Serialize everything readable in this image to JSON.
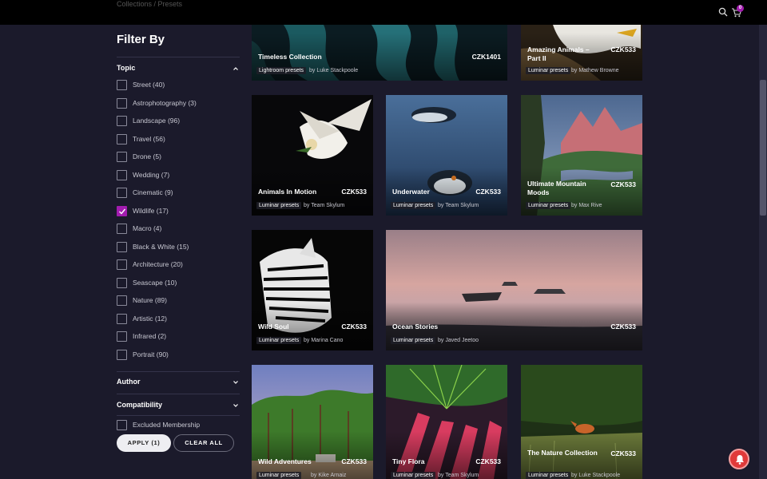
{
  "header": {
    "breadcrumb": "Collections / Presets",
    "cart_count": "0"
  },
  "sidebar": {
    "title": "Filter By",
    "topic_label": "Topic",
    "topics": [
      {
        "label": "Street (40)",
        "checked": false
      },
      {
        "label": "Astrophotography (3)",
        "checked": false
      },
      {
        "label": "Landscape (96)",
        "checked": false
      },
      {
        "label": "Travel (56)",
        "checked": false
      },
      {
        "label": "Drone (5)",
        "checked": false
      },
      {
        "label": "Wedding (7)",
        "checked": false
      },
      {
        "label": "Cinematic (9)",
        "checked": false
      },
      {
        "label": "Wildlife (17)",
        "checked": true
      },
      {
        "label": "Macro (4)",
        "checked": false
      },
      {
        "label": "Black & White (15)",
        "checked": false
      },
      {
        "label": "Architecture (20)",
        "checked": false
      },
      {
        "label": "Seascape (10)",
        "checked": false
      },
      {
        "label": "Nature (89)",
        "checked": false
      },
      {
        "label": "Artistic (12)",
        "checked": false
      },
      {
        "label": "Infrared (2)",
        "checked": false
      },
      {
        "label": "Portrait (90)",
        "checked": false
      }
    ],
    "author_label": "Author",
    "compatibility_label": "Compatibility",
    "excluded": {
      "label": "Excluded Membership",
      "checked": false
    },
    "apply_label": "APPLY (1)",
    "clear_label": "CLEAR ALL"
  },
  "products": [
    {
      "title": "Timeless Collection",
      "code": "CZK1401",
      "type": "Lightroom presets",
      "author": "by Luke Stackpoole"
    },
    {
      "title": "Amazing Animals – Part II",
      "code": "CZK533",
      "type": "Luminar presets",
      "author": "by Mathew Browne"
    },
    {
      "title": "Animals In Motion",
      "code": "CZK533",
      "type": "Luminar presets",
      "author": "by Team Skylum"
    },
    {
      "title": "Underwater",
      "code": "CZK533",
      "type": "Luminar presets",
      "author": "by Team Skylum"
    },
    {
      "title": "Ultimate Mountain Moods",
      "code": "CZK533",
      "type": "Luminar presets",
      "author": "by Max Rive"
    },
    {
      "title": "Wild Soul",
      "code": "CZK533",
      "type": "Luminar presets",
      "author": "by Marina Cano"
    },
    {
      "title": "Ocean Stories",
      "code": "CZK533",
      "type": "Luminar presets",
      "author": "by Javed Jeetoo"
    },
    {
      "title": "Wild Adventures",
      "code": "CZK533",
      "type": "Luminar presets",
      "author": "by Kike Arnaiz"
    },
    {
      "title": "Tiny Flora",
      "code": "CZK533",
      "type": "Luminar presets",
      "author": "by Team Skylum"
    },
    {
      "title": "The Nature Collection",
      "code": "CZK533",
      "type": "Luminar presets",
      "author": "by Luke Stackpoole"
    }
  ],
  "colors": {
    "accent": "#a21caf",
    "background": "#1b1a2b",
    "topbar": "#000000"
  }
}
